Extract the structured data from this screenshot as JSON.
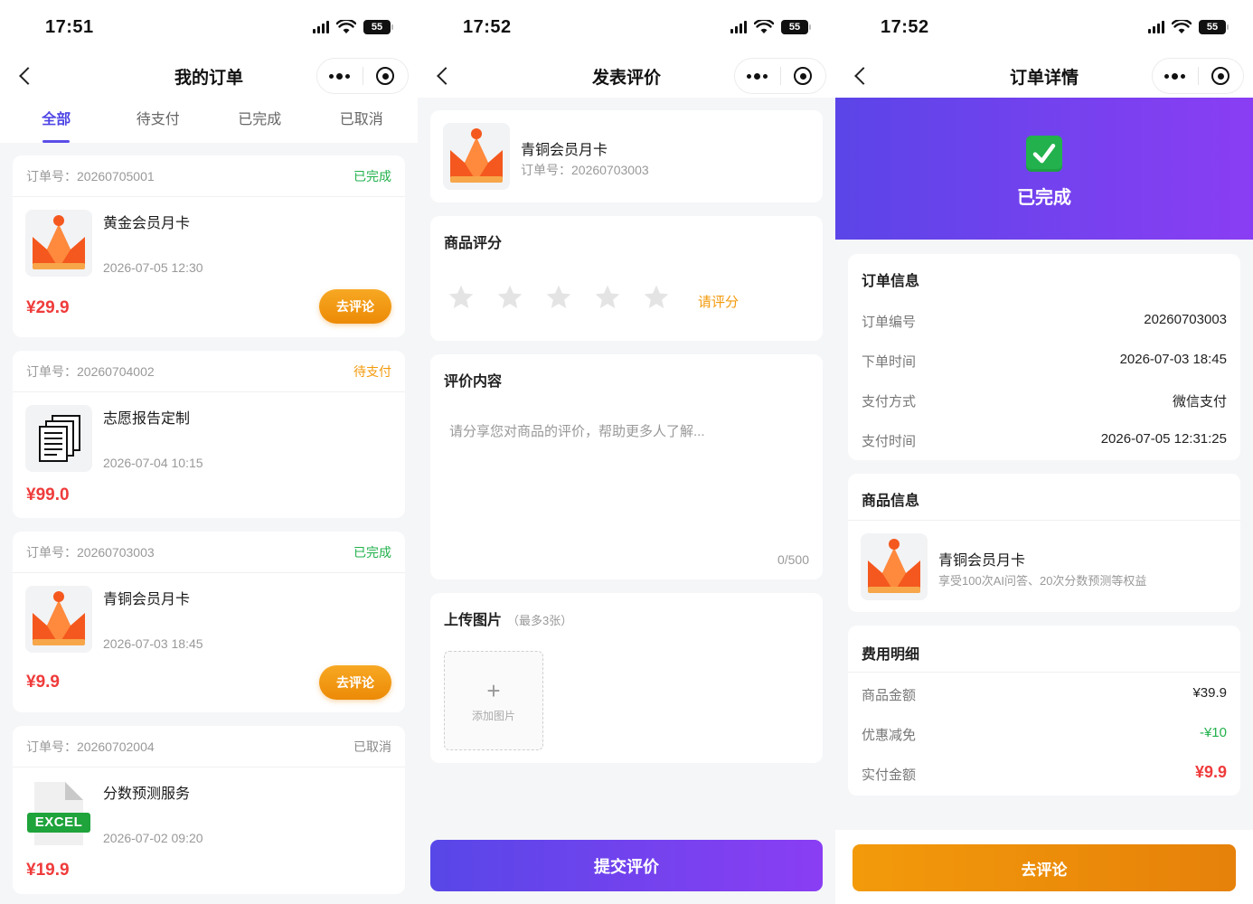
{
  "screen_orders": {
    "status": {
      "time": "17:51",
      "battery": "55"
    },
    "nav": {
      "title": "我的订单"
    },
    "tabs": [
      "全部",
      "待支付",
      "已完成",
      "已取消"
    ],
    "orders": [
      {
        "order_label": "订单号：20260705001",
        "status": "已完成",
        "name": "黄金会员月卡",
        "time": "2026-07-05 12:30",
        "price": "¥29.9",
        "action": "去评论",
        "thumb": "crown-icon"
      },
      {
        "order_label": "订单号：20260704002",
        "status": "待支付",
        "name": "志愿报告定制",
        "time": "2026-07-04 10:15",
        "price": "¥99.0",
        "thumb": "documents-icon"
      },
      {
        "order_label": "订单号：20260703003",
        "status": "已完成",
        "name": "青铜会员月卡",
        "time": "2026-07-03 18:45",
        "price": "¥9.9",
        "action": "去评论",
        "thumb": "crown-icon"
      },
      {
        "order_label": "订单号：20260702004",
        "status": "已取消",
        "name": "分数预测服务",
        "time": "2026-07-02 09:20",
        "price": "¥19.9",
        "thumb": "excel-icon",
        "thumb_text": "EXCEL"
      }
    ]
  },
  "screen_review": {
    "status": {
      "time": "17:52",
      "battery": "55"
    },
    "nav": {
      "title": "发表评价"
    },
    "product": {
      "name": "青铜会员月卡",
      "order_label": "订单号：20260703003"
    },
    "rating": {
      "title": "商品评分",
      "hint": "请评分",
      "max_stars": 5
    },
    "content": {
      "title": "评价内容",
      "placeholder": "请分享您对商品的评价，帮助更多人了解...",
      "counter": "0/500"
    },
    "upload": {
      "title": "上传图片",
      "note": "（最多3张）",
      "add_label": "添加图片"
    },
    "submit_label": "提交评价"
  },
  "screen_detail": {
    "status": {
      "time": "17:52",
      "battery": "55"
    },
    "nav": {
      "title": "订单详情"
    },
    "hero": {
      "status": "已完成"
    },
    "order_info": {
      "title": "订单信息",
      "rows": [
        {
          "label": "订单编号",
          "value": "20260703003"
        },
        {
          "label": "下单时间",
          "value": "2026-07-03 18:45"
        },
        {
          "label": "支付方式",
          "value": "微信支付"
        },
        {
          "label": "支付时间",
          "value": "2026-07-05 12:31:25"
        }
      ]
    },
    "product_info": {
      "title": "商品信息",
      "name": "青铜会员月卡",
      "desc": "享受100次AI问答、20次分数预测等权益"
    },
    "fee": {
      "title": "费用明细",
      "rows": [
        {
          "label": "商品金额",
          "value": "¥39.9"
        },
        {
          "label": "优惠减免",
          "value": "-¥10"
        },
        {
          "label": "实付金额",
          "value": "¥9.9"
        }
      ]
    },
    "action_label": "去评论"
  },
  "colors": {
    "accent": "#5b4ee8",
    "done": "#22b14c",
    "pending": "#f39a0b",
    "price": "#ef3b3b",
    "cta_orange": "#f39a0b"
  }
}
